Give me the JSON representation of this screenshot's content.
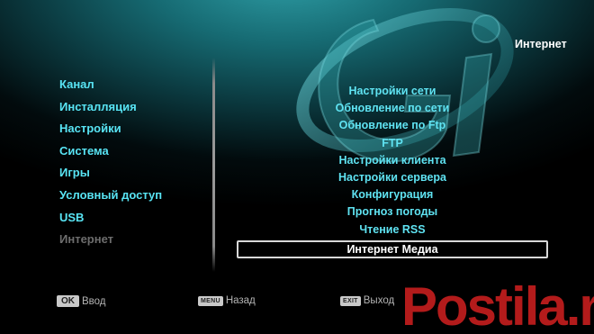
{
  "header": {
    "title": "Интернет"
  },
  "main_menu": {
    "items": [
      {
        "label": "Канал"
      },
      {
        "label": "Инсталляция"
      },
      {
        "label": "Настройки"
      },
      {
        "label": "Система"
      },
      {
        "label": "Игры"
      },
      {
        "label": "Условный доступ"
      },
      {
        "label": "USB"
      },
      {
        "label": "Интернет",
        "state": "active-dim"
      }
    ]
  },
  "sub_menu": {
    "items": [
      {
        "label": "Настройки сети"
      },
      {
        "label": "Обновление по сети"
      },
      {
        "label": "Обновление по Ftp"
      },
      {
        "label": "FTP"
      },
      {
        "label": "Настройки клиента"
      },
      {
        "label": "Настройки сервера"
      },
      {
        "label": "Конфигурация"
      },
      {
        "label": "Прогноз погоды"
      },
      {
        "label": "Чтение RSS"
      },
      {
        "label": "Интернет Медиа",
        "selected": true
      }
    ]
  },
  "footer": {
    "ok_key": "OK",
    "ok_label": "Ввод",
    "menu_key": "MENU",
    "menu_label": "Назад",
    "exit_key": "EXIT",
    "exit_label": "Выход"
  },
  "watermark": {
    "text": "Postila.ru"
  },
  "colors": {
    "accent": "#5fe3f2",
    "dim": "#6d6d6d",
    "selected_border": "#d8d8d8",
    "watermark": "#b31b1b"
  },
  "icons": {
    "logo": "gi-swoosh-logo"
  }
}
